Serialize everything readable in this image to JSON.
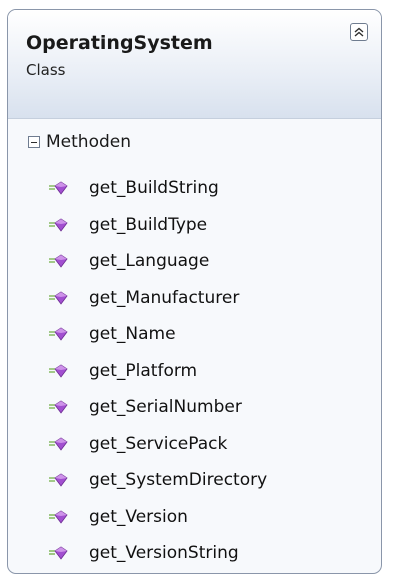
{
  "class": {
    "name": "OperatingSystem",
    "stereotype": "Class"
  },
  "compartment": {
    "label": "Methoden",
    "expanded": true
  },
  "methods": [
    {
      "label": "get_BuildString",
      "icon": "method-icon"
    },
    {
      "label": "get_BuildType",
      "icon": "method-icon"
    },
    {
      "label": "get_Language",
      "icon": "method-icon"
    },
    {
      "label": "get_Manufacturer",
      "icon": "method-icon"
    },
    {
      "label": "get_Name",
      "icon": "method-icon"
    },
    {
      "label": "get_Platform",
      "icon": "method-icon"
    },
    {
      "label": "get_SerialNumber",
      "icon": "method-icon"
    },
    {
      "label": "get_ServicePack",
      "icon": "method-icon"
    },
    {
      "label": "get_SystemDirectory",
      "icon": "method-icon"
    },
    {
      "label": "get_Version",
      "icon": "method-icon"
    },
    {
      "label": "get_VersionString",
      "icon": "method-icon"
    }
  ],
  "colors": {
    "border": "#8a96aa",
    "header_gradient_end": "#d8e1ee",
    "method_icon": "#a24fd0"
  }
}
